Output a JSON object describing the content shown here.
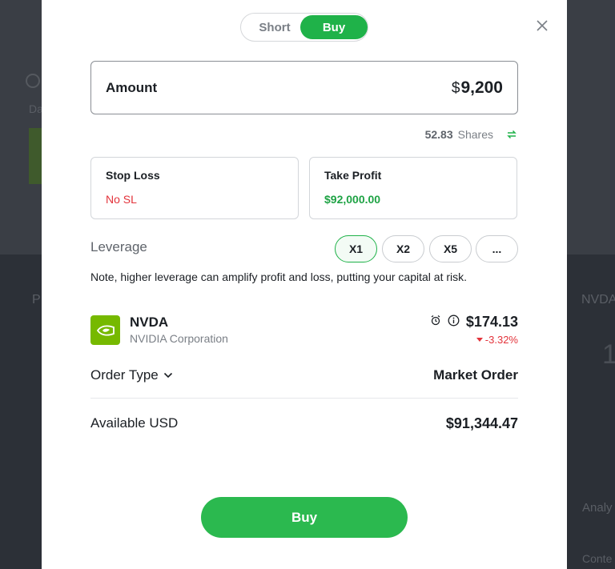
{
  "background": {
    "fragments": [
      "Da",
      "P",
      "NVDA",
      "1",
      "Analy",
      "Conte"
    ]
  },
  "modal": {
    "side_toggle": {
      "short_label": "Short",
      "buy_label": "Buy",
      "selected": "Buy"
    },
    "close_icon": "close-icon",
    "amount": {
      "label": "Amount",
      "currency_symbol": "$",
      "value": "9,200"
    },
    "shares": {
      "value": "52.83",
      "unit": "Shares",
      "icon": "swap-icon"
    },
    "stop_loss": {
      "title": "Stop Loss",
      "value": "No SL"
    },
    "take_profit": {
      "title": "Take Profit",
      "value": "$92,000.00"
    },
    "leverage": {
      "label": "Leverage",
      "options": [
        "X1",
        "X2",
        "X5",
        "..."
      ],
      "selected": "X1"
    },
    "note": "Note, higher leverage can amplify profit and loss, putting your capital at risk.",
    "stock": {
      "ticker": "NVDA",
      "name": "NVIDIA Corporation",
      "price": "$174.13",
      "change": "-3.32%",
      "icons": [
        "alarm-icon",
        "info-icon"
      ]
    },
    "order_type": {
      "label": "Order Type",
      "value": "Market Order"
    },
    "available": {
      "label": "Available USD",
      "value": "$91,344.47"
    },
    "buy_button": "Buy"
  },
  "colors": {
    "accent_green": "#1fb249",
    "loss_red": "#e3333b",
    "text_dark": "#1b1f24",
    "text_muted": "#7a7f86"
  }
}
